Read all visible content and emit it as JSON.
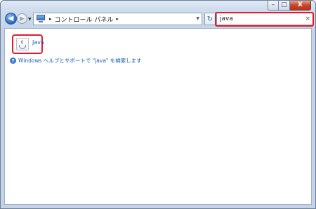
{
  "window": {
    "minimize_glyph": "–",
    "maximize_glyph": "□",
    "close_glyph": "X"
  },
  "nav": {
    "back_glyph": "◀",
    "forward_glyph": "▶",
    "breadcrumb": {
      "lead_arrow": "▸",
      "items": [
        "コントロール パネル"
      ],
      "trail_arrow": "▸"
    },
    "refresh_glyph": "↻"
  },
  "search": {
    "value": "java",
    "clear_glyph": "×"
  },
  "results": [
    {
      "label": "Java",
      "icon": "java-icon"
    }
  ],
  "help_link": "Windows ヘルプとサポートで \"java\" を検索します"
}
